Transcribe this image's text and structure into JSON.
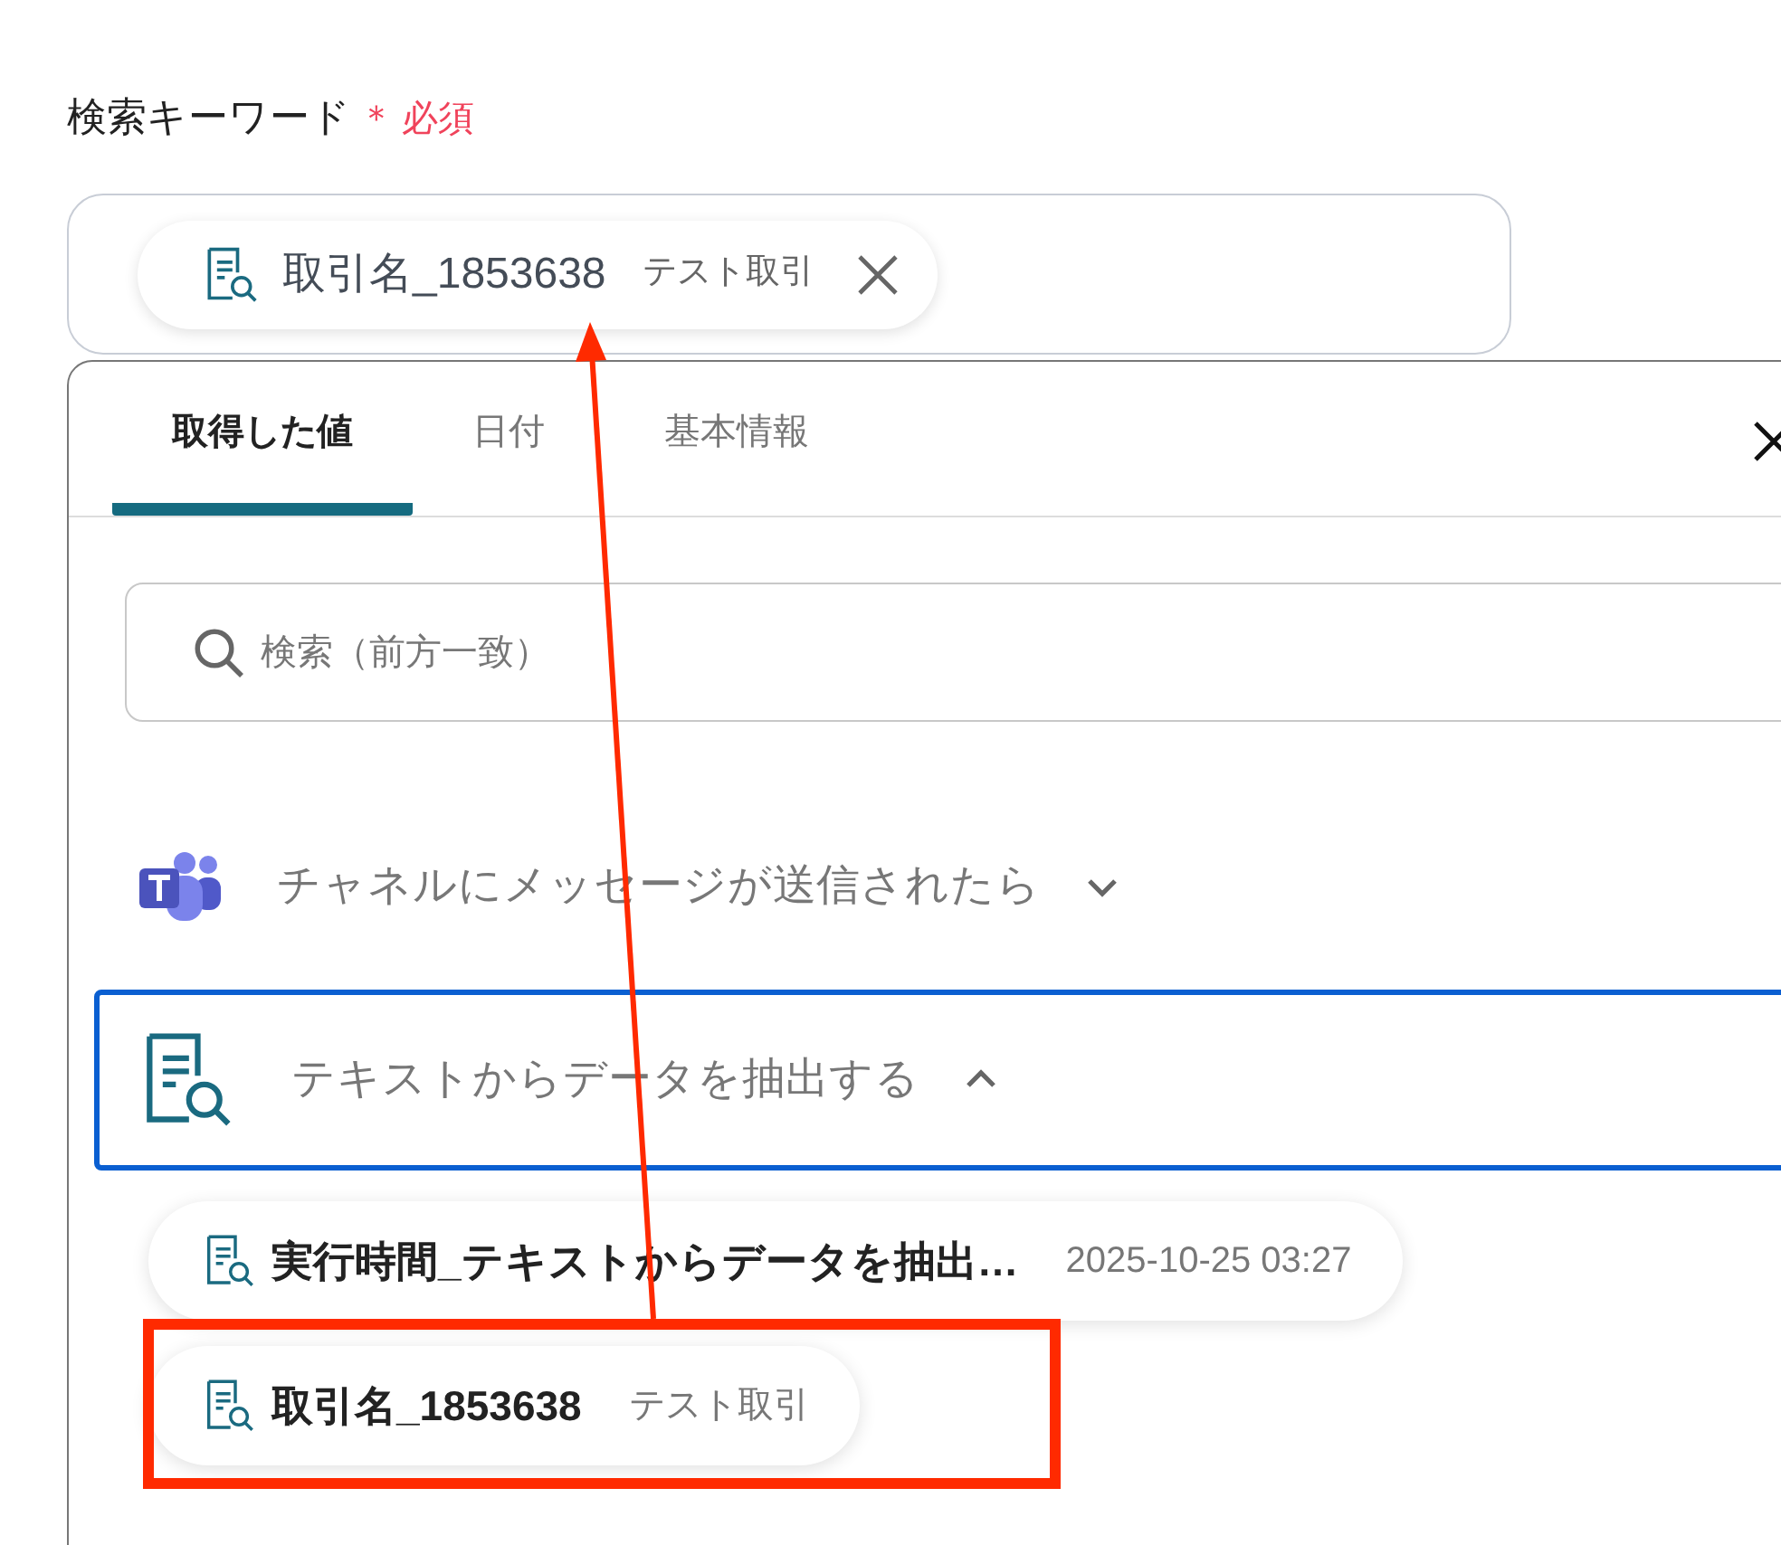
{
  "field": {
    "label": "検索キーワード",
    "required_mark": "＊",
    "required_text": "必須",
    "token": {
      "label": "取引名_1853638",
      "meta": "テスト取引"
    }
  },
  "tabs": [
    {
      "label": "取得した値",
      "selected": true
    },
    {
      "label": "日付",
      "selected": false
    },
    {
      "label": "基本情報",
      "selected": false
    }
  ],
  "search": {
    "placeholder": "検索（前方一致）"
  },
  "groups": [
    {
      "kind": "teams",
      "title": "チャネルにメッセージが送信されたら",
      "expanded": false,
      "selected": false
    },
    {
      "kind": "doc",
      "title": "テキストからデータを抽出する",
      "expanded": true,
      "selected": true,
      "items": [
        {
          "label": "実行時間_テキストからデータを抽出…",
          "meta": "2025-10-25 03:27"
        },
        {
          "label": "取引名_1853638",
          "meta": "テスト取引"
        }
      ]
    }
  ],
  "annotations": {
    "highlight_box": true,
    "arrow": true
  }
}
